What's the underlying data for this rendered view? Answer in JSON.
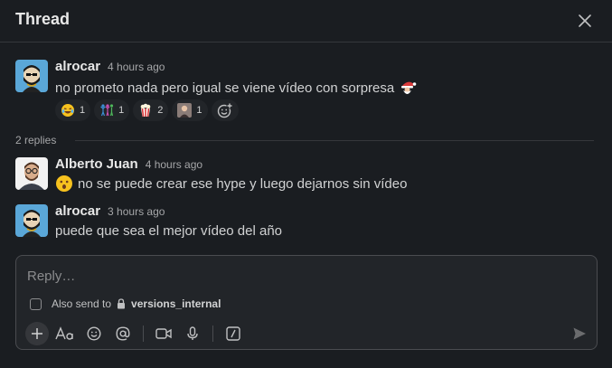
{
  "header": {
    "title": "Thread"
  },
  "parent": {
    "author": "alrocar",
    "time": "4 hours ago",
    "text": "no prometo nada pero igual se viene vídeo con sorpresa",
    "reactions": [
      {
        "icon": "joy-emoji-icon",
        "count": "1"
      },
      {
        "icon": "dancers-emoji-icon",
        "count": "1"
      },
      {
        "icon": "popcorn-emoji-icon",
        "count": "2"
      },
      {
        "icon": "custom-person-emoji-icon",
        "count": "1"
      }
    ]
  },
  "replies": {
    "count_label": "2 replies",
    "items": [
      {
        "author": "Alberto Juan",
        "time": "4 hours ago",
        "text": "no se puede crear ese hype y luego dejarnos sin vídeo"
      },
      {
        "author": "alrocar",
        "time": "3 hours ago",
        "text": "puede que sea el mejor vídeo del año"
      }
    ]
  },
  "composer": {
    "placeholder": "Reply…",
    "also_send_label": "Also send to",
    "channel": "versions_internal"
  }
}
